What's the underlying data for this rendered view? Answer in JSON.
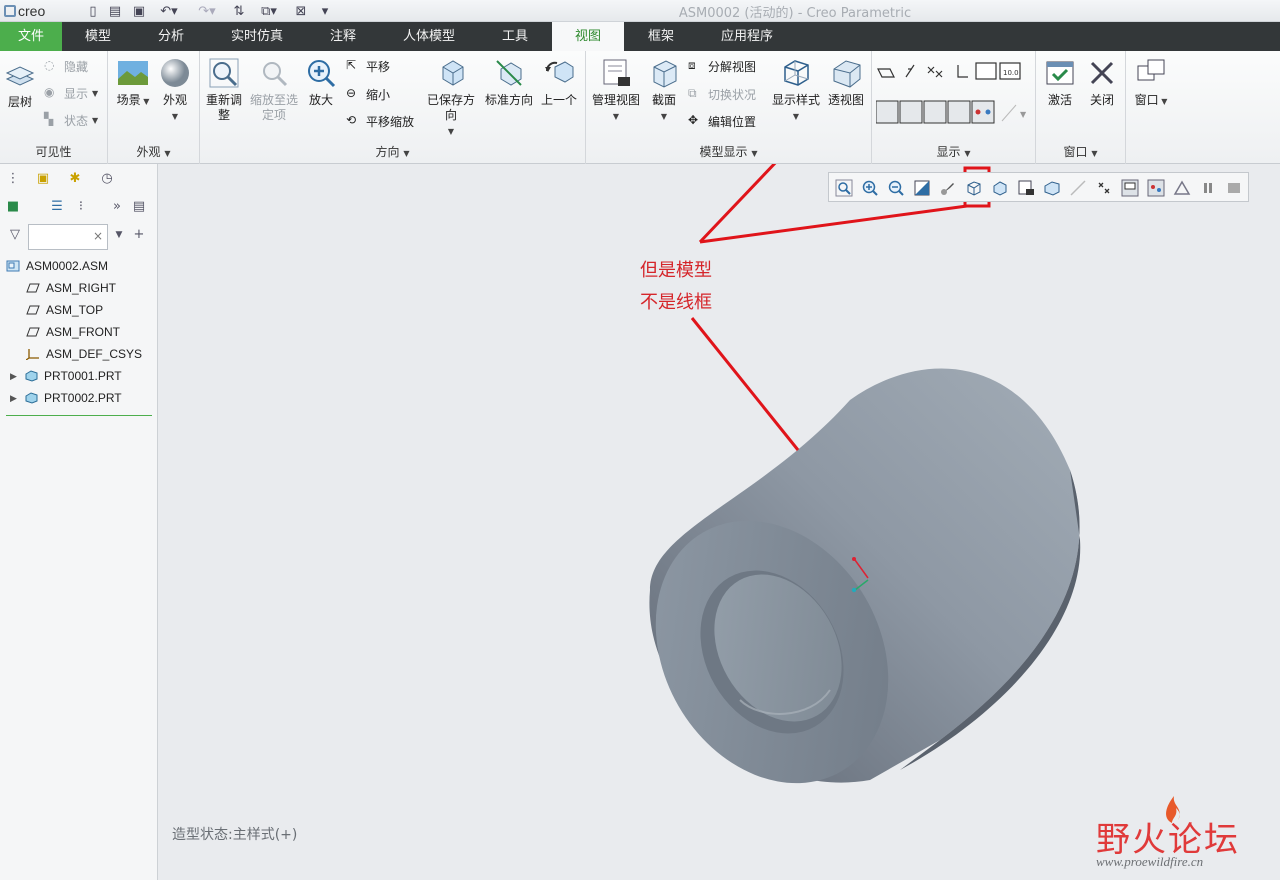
{
  "app": {
    "logo": "creo",
    "window_title": "ASM0002 (活动的) - Creo Parametric"
  },
  "tabs": [
    {
      "label": "文件"
    },
    {
      "label": "模型"
    },
    {
      "label": "分析"
    },
    {
      "label": "实时仿真"
    },
    {
      "label": "注释"
    },
    {
      "label": "人体模型"
    },
    {
      "label": "工具"
    },
    {
      "label": "视图",
      "active": true
    },
    {
      "label": "框架"
    },
    {
      "label": "应用程序"
    }
  ],
  "ribbon": {
    "visibility": {
      "label": "可见性",
      "layer_tree": "层树",
      "hide": "隐藏",
      "show": "显示",
      "status": "状态"
    },
    "appearance": {
      "label": "外观",
      "scene": "场景",
      "appearance": "外观"
    },
    "orientation": {
      "label": "方向",
      "refit": "重新调整",
      "zoom_to_selected": "缩放至选定项",
      "zoom_in": "放大",
      "pan": "平移",
      "zoom_out": "缩小",
      "pan_zoom": "平移缩放",
      "saved_orientations": "已保存方向",
      "standard_orientation": "标准方向",
      "previous": "上一个"
    },
    "model_display": {
      "label": "模型显示",
      "manage_views": "管理视图",
      "section": "截面",
      "explode_view": "分解视图",
      "toggle_status": "切换状况",
      "edit_position": "编辑位置",
      "display_style": "显示样式",
      "perspective": "透视图"
    },
    "display": {
      "label": "显示"
    },
    "window": {
      "label": "窗口",
      "activate": "激活",
      "close": "关闭",
      "windows": "窗口"
    }
  },
  "model_tree": {
    "items": [
      {
        "label": "ASM0002.ASM",
        "icon": "assembly-icon",
        "level": 0
      },
      {
        "label": "ASM_RIGHT",
        "icon": "datum-plane-icon",
        "level": 1
      },
      {
        "label": "ASM_TOP",
        "icon": "datum-plane-icon",
        "level": 1
      },
      {
        "label": "ASM_FRONT",
        "icon": "datum-plane-icon",
        "level": 1
      },
      {
        "label": "ASM_DEF_CSYS",
        "icon": "csys-icon",
        "level": 1
      },
      {
        "label": "PRT0001.PRT",
        "icon": "part-icon",
        "level": 1,
        "expandable": true
      },
      {
        "label": "PRT0002.PRT",
        "icon": "part-icon",
        "level": 1,
        "expandable": true
      }
    ]
  },
  "graphics": {
    "model_state": "造型状态:主样式(+)"
  },
  "annotation": {
    "line1": "但是模型",
    "line2": "不是线框",
    "color": "#d5252a"
  },
  "watermark": {
    "title": "野火论坛",
    "url": "www.proewildfire.cn"
  },
  "colors": {
    "file_tab": "#4cae4c",
    "active_tab_text": "#2f8a2f",
    "tab_bar": "#333739",
    "highlight_box": "#e0141a"
  }
}
